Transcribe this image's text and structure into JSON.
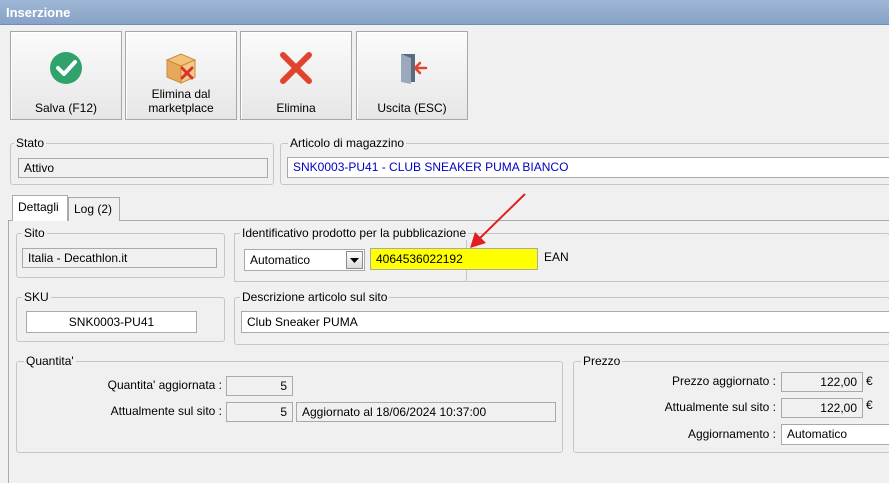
{
  "window": {
    "title": "Inserzione"
  },
  "toolbar": {
    "save_label": "Salva (F12)",
    "delete_marketplace_label": "Elimina dal\nmarketplace",
    "delete_label": "Elimina",
    "exit_label": "Uscita (ESC)"
  },
  "stato": {
    "title": "Stato",
    "value": "Attivo"
  },
  "articolo": {
    "title": "Articolo di magazzino",
    "value": "SNK0003-PU41 - CLUB SNEAKER PUMA BIANCO"
  },
  "tabs": [
    {
      "label": "Dettagli"
    },
    {
      "label": "Log (2)"
    }
  ],
  "sito": {
    "title": "Sito",
    "value": "Italia - Decathlon.it"
  },
  "identificativo": {
    "title": "Identificativo prodotto per la pubblicazione",
    "mode": "Automatico",
    "value": "4064536022192",
    "type": "EAN"
  },
  "sku": {
    "title": "SKU",
    "value": "SNK0003-PU41"
  },
  "descrizione": {
    "title": "Descrizione articolo sul sito",
    "value": "Club Sneaker PUMA"
  },
  "quantita": {
    "title": "Quantita'",
    "aggiornata_label": "Quantita' aggiornata :",
    "aggiornata_value": "5",
    "sul_sito_label": "Attualmente sul sito :",
    "sul_sito_value": "5",
    "status": "Aggiornato al 18/06/2024 10:37:00"
  },
  "prezzo": {
    "title": "Prezzo",
    "aggiornato_label": "Prezzo aggiornato :",
    "aggiornato_value": "122,00",
    "sul_sito_label": "Attualmente sul sito :",
    "sul_sito_value": "122,00",
    "currency": "€",
    "aggiornamento_label": "Aggiornamento :",
    "aggiornamento_value": "Automatico"
  },
  "colors": {
    "accent_yellow": "#ffff00",
    "arrow_red": "#e02020",
    "title_bar": "#8aa6c9"
  }
}
